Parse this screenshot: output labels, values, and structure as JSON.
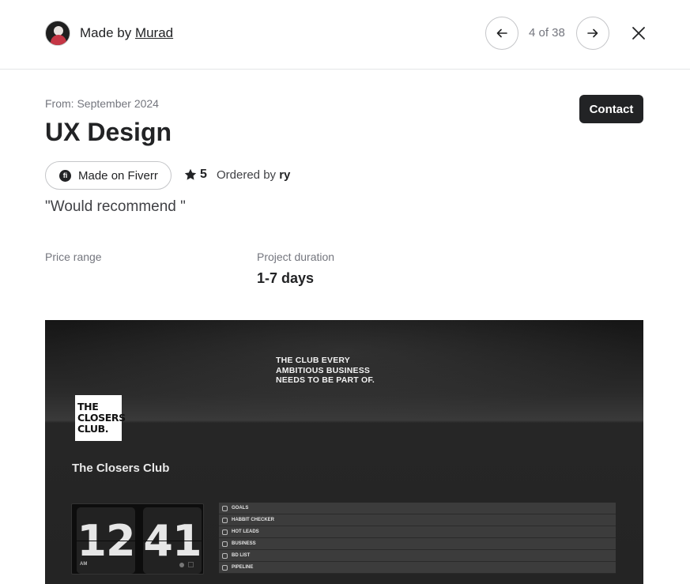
{
  "header": {
    "made_by_prefix": "Made by",
    "maker_name": "Murad",
    "counter": "4 of 38"
  },
  "project": {
    "from": "From: September 2024",
    "title": "UX Design",
    "contact_label": "Contact",
    "made_on_label": "Made on Fiverr",
    "fiverr_glyph": "fi",
    "rating": "5",
    "ordered_by_prefix": "Ordered by",
    "buyer": "ry",
    "quote": "\"Would recommend \"",
    "price_range_label": "Price range",
    "duration_label": "Project duration",
    "duration_value": "1-7 days"
  },
  "image": {
    "tagline": [
      "THE CLUB EVERY",
      "AMBITIOUS BUSINESS",
      "NEEDS TO BE PART OF."
    ],
    "logo_lines": [
      "THE",
      "CLOSERS",
      "CLUB."
    ],
    "club_title": "The Closers Club",
    "clock_hours": "12",
    "clock_minutes": "41",
    "clock_ampm": "AM",
    "menu_items": [
      "GOALS",
      "HABBIT CHECKER",
      "HOT LEADS",
      "BUSINESS",
      "BD LIST",
      "PIPELINE"
    ]
  },
  "icons": {
    "prev": "arrow-left-icon",
    "next": "arrow-right-icon",
    "close": "close-icon",
    "star": "star-icon"
  }
}
